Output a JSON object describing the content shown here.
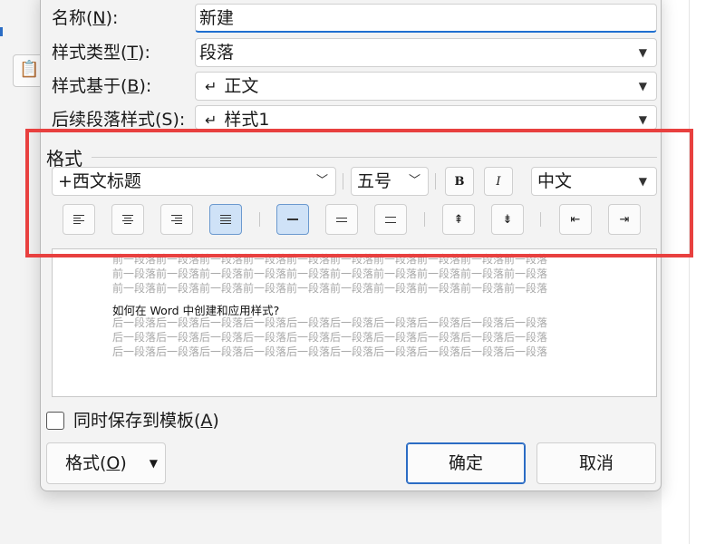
{
  "fields": {
    "name": {
      "label": "名称(",
      "key": "N",
      "tail": "):",
      "value": "新建"
    },
    "style_type": {
      "label": "样式类型(",
      "key": "T",
      "tail": "):",
      "value": "段落"
    },
    "based_on": {
      "label": "样式基于(",
      "key": "B",
      "tail": "):",
      "value": "正文"
    },
    "next_style": {
      "label": "后续段落样式(S):",
      "value": "样式1"
    }
  },
  "format_section": {
    "title": "格式",
    "font": "+西文标题",
    "size": "五号",
    "bold": "B",
    "italic": "I",
    "script": "中文"
  },
  "alignment": {
    "selected": "justify",
    "spacing_selected": "single"
  },
  "preview": {
    "before_line": "前一段落前一段落前一段落前一段落前一段落前一段落前一段落前一段落前一段落前一段落",
    "sample_text": "如何在 Word 中创建和应用样式?",
    "after_line": "后一段落后一段落后一段落后一段落后一段落后一段落后一段落后一段落后一段落后一段落"
  },
  "save_template": {
    "label": "同时保存到模板(",
    "key": "A",
    "tail": ")",
    "checked": false
  },
  "buttons": {
    "format": {
      "label": "格式(",
      "key": "O",
      "tail": ")"
    },
    "ok": "确定",
    "cancel": "取消"
  },
  "highlight_color": "#e8403f",
  "accent_color": "#1f6fd0"
}
